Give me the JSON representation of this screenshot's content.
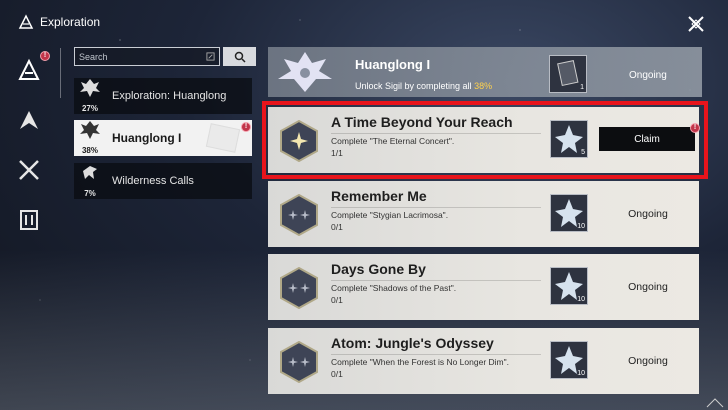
{
  "header": {
    "title": "Exploration"
  },
  "rail": {
    "badge": "!"
  },
  "search": {
    "placeholder": "Search"
  },
  "categories": [
    {
      "label": "Exploration: Huanglong",
      "pct": "27%"
    },
    {
      "label": "Huanglong I",
      "pct": "38%",
      "badge": "!"
    },
    {
      "label": "Wilderness Calls",
      "pct": "7%"
    }
  ],
  "topcard": {
    "title": "Huanglong I",
    "subtitle": "Unlock Sigil by completing all",
    "pct": "38%",
    "reward_qty": "1",
    "status": "Ongoing"
  },
  "quests": [
    {
      "title": "A Time Beyond Your Reach",
      "desc": "Complete \"The Eternal Concert\".",
      "progress": "1/1",
      "reward_qty": "5",
      "action": "Claim",
      "badge": "!"
    },
    {
      "title": "Remember Me",
      "desc": "Complete \"Stygian Lacrimosa\".",
      "progress": "0/1",
      "reward_qty": "10",
      "status": "Ongoing"
    },
    {
      "title": "Days Gone By",
      "desc": "Complete \"Shadows of the Past\".",
      "progress": "0/1",
      "reward_qty": "10",
      "status": "Ongoing"
    },
    {
      "title": "Atom: Jungle's Odyssey",
      "desc": "Complete \"When the Forest is No Longer Dim\".",
      "progress": "0/1",
      "reward_qty": "10",
      "status": "Ongoing"
    }
  ],
  "colors": {
    "highlight": "#e8141c",
    "accent": "#ffd24d",
    "badge": "#c13449"
  }
}
